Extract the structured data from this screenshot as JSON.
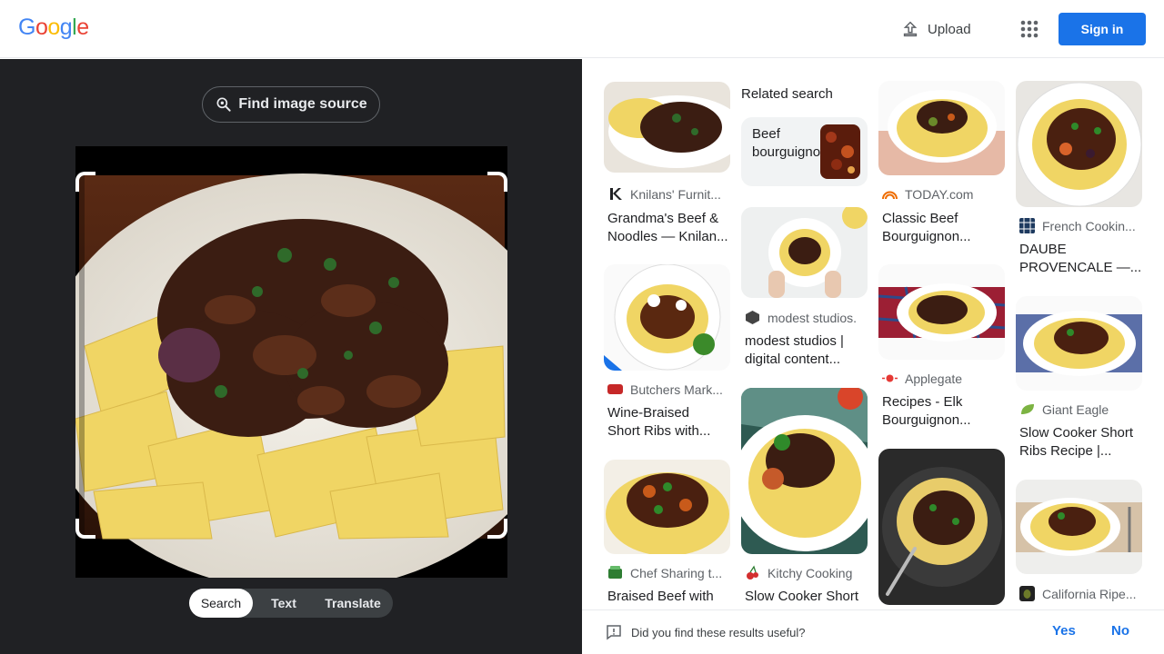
{
  "header": {
    "logo_letters": [
      "G",
      "o",
      "o",
      "g",
      "l",
      "e"
    ],
    "logo_colors": [
      "#4285f4",
      "#ea4335",
      "#fbbc05",
      "#4285f4",
      "#34a853",
      "#ea4335"
    ],
    "upload_label": "Upload",
    "apps_icon": "apps-grid-icon",
    "signin_label": "Sign in"
  },
  "lens": {
    "find_source_label": "Find image source",
    "modes": [
      "Search",
      "Text",
      "Translate"
    ],
    "active_mode": "Search"
  },
  "results": {
    "related_heading": "Related search",
    "related_query": "Beef bourguignon",
    "items": [
      {
        "source": "Knilans' Furnit...",
        "title_line1": "Grandma's Beef &",
        "title_line2": "Noodles — Knilan...",
        "fav_icon": "k-logo-icon"
      },
      {
        "source": "Butchers Mark...",
        "title_line1": "Wine-Braised",
        "title_line2": "Short Ribs with...",
        "fav_icon": "butchers-logo-icon"
      },
      {
        "source": "Chef Sharing t...",
        "title_line1": "Braised Beef with",
        "title_line2": "",
        "fav_icon": "chef-logo-icon"
      },
      {
        "source": "modest studios.",
        "title_line1": "modest studios |",
        "title_line2": "digital content...",
        "fav_icon": "cube-logo-icon"
      },
      {
        "source": "Kitchy Cooking",
        "title_line1": "Slow Cooker Short",
        "title_line2": "",
        "fav_icon": "cherry-logo-icon"
      },
      {
        "source": "TODAY.com",
        "title_line1": "Classic Beef",
        "title_line2": "Bourguignon...",
        "fav_icon": "today-logo-icon"
      },
      {
        "source": "Applegate",
        "title_line1": "Recipes - Elk",
        "title_line2": "Bourguignon...",
        "fav_icon": "applegate-logo-icon"
      },
      {
        "source": "French Cookin...",
        "title_line1": "DAUBE",
        "title_line2": "PROVENCALE —...",
        "fav_icon": "french-logo-icon"
      },
      {
        "source": "Giant Eagle",
        "title_line1": "Slow Cooker Short",
        "title_line2": "Ribs Recipe |...",
        "fav_icon": "leaf-logo-icon"
      },
      {
        "source": "California Ripe...",
        "title_line1": "",
        "title_line2": "",
        "fav_icon": "olive-logo-icon"
      }
    ]
  },
  "feedback": {
    "question": "Did you find these results useful?",
    "yes_label": "Yes",
    "no_label": "No"
  },
  "colors": {
    "accent": "#1a73e8",
    "dark_panel": "#202124",
    "pasta": "#f2d66a",
    "sauce": "#3b1d12"
  }
}
